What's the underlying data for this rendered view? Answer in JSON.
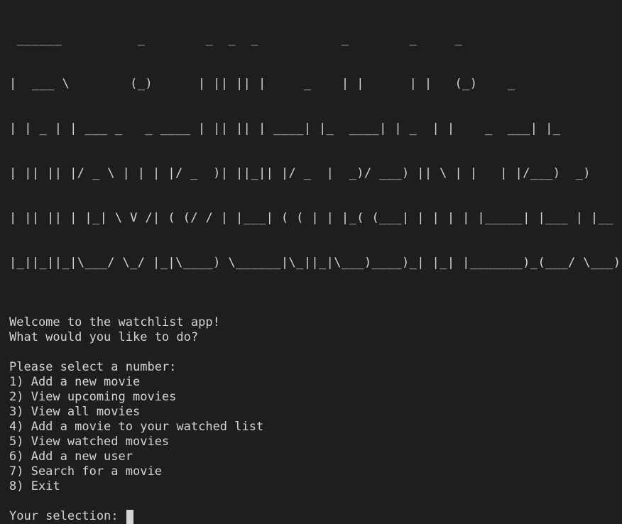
{
  "terminal": {
    "banner_lines": [
      " ______          _        _  _  _           _        _     _   ",
      "|  ___ \\        (_)      | || || |     _    | |      | |   (_)    _",
      "| | _ | | ___ _   _ ____ | || || | ____| |_  ____| | _  | |    _  ___| |_",
      "| || || |/ _ \\ | | | |/ _  )| ||_|| |/ _  |  _)/ ___) || \\ | |   | |/___)  _)",
      "| || || | |_| \\ V /| ( (/ / | |___| ( ( | | |_( (___| | | | | |_____| |___ | |__",
      "|_||_||_|\\___/ \\_/ |_|\\____) \\______|\\_||_|\\___)____)_| |_| |_______)_(___/ \\___)"
    ],
    "welcome": "Welcome to the watchlist app!",
    "question": "What would you like to do?",
    "select_prompt": "Please select a number:",
    "menu": [
      "1) Add a new movie",
      "2) View upcoming movies",
      "3) View all movies",
      "4) Add a movie to your watched list",
      "5) View watched movies",
      "6) Add a new user",
      "7) Search for a movie",
      "8) Exit"
    ],
    "input_prompt": "Your selection: ",
    "input_value": ""
  }
}
